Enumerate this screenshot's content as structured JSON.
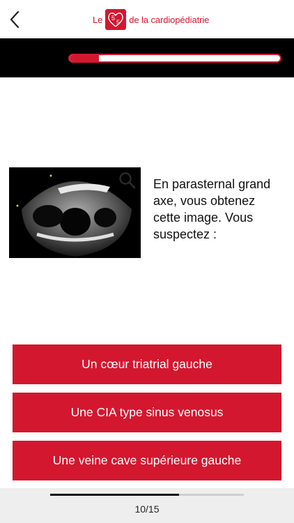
{
  "header": {
    "back_icon": "chevron-left-icon",
    "logo": {
      "prefix": "Le",
      "number_a": "5",
      "number_b": "5",
      "suffix": "de la cardiopédiatrie",
      "color": "#d3172f"
    }
  },
  "quiz_progress": {
    "fraction": 0.14,
    "color": "#d3172f"
  },
  "question": {
    "image_icon": "echocardiogram-image",
    "zoom_icon": "search-icon",
    "text": "En parasternal grand axe, vous obtenez cette image. Vous suspectez :"
  },
  "answers": [
    {
      "label": "Un cœur triatrial gauche"
    },
    {
      "label": "Une CIA type sinus venosus"
    },
    {
      "label": "Une veine cave supérieure gauche"
    }
  ],
  "footer": {
    "counter": "10/15",
    "current": 10,
    "total": 15
  }
}
